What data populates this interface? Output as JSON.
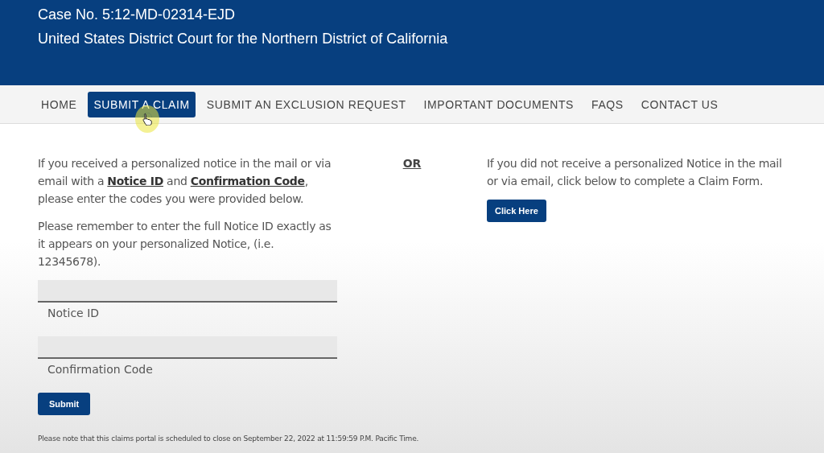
{
  "header": {
    "case_number": "Case No. 5:12-MD-02314-EJD",
    "court": "United States District Court for the Northern District of California"
  },
  "nav": [
    {
      "label": "HOME",
      "selected": false
    },
    {
      "label": "SUBMIT A CLAIM",
      "selected": true
    },
    {
      "label": "SUBMIT AN EXCLUSION REQUEST",
      "selected": false
    },
    {
      "label": "IMPORTANT DOCUMENTS",
      "selected": false
    },
    {
      "label": "FAQS",
      "selected": false
    },
    {
      "label": "CONTACT US",
      "selected": false
    }
  ],
  "left": {
    "intro": "If you received a personalized notice in the mail or via email with a **Notice ID** and **Confirmation Code**, please enter the codes you were provided below.",
    "reminder": "Please remember to enter the full Notice ID exactly as it appears on your personalized Notice, (i.e. 12345678).",
    "fields": [
      {
        "label": "Notice ID"
      },
      {
        "label": "Confirmation Code"
      }
    ],
    "submit": "Submit"
  },
  "separator": "OR",
  "right": {
    "text": "If you did not receive a personalized Notice in the mail or via email, click below to complete a Claim Form.",
    "button": "Click Here"
  },
  "footer_note": "Please note that this claims portal is scheduled to close on September 22, 2022 at 11:59:59 P.M. Pacific Time."
}
